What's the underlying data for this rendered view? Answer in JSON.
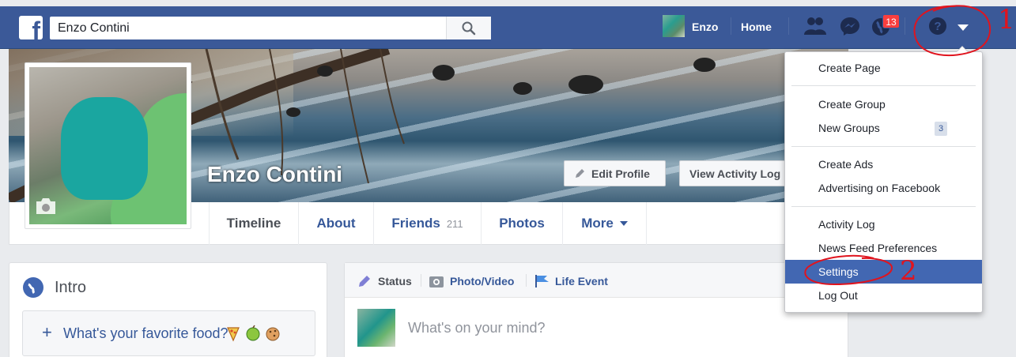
{
  "topbar": {
    "logo": "f",
    "search_value": "Enzo Contini",
    "user_name": "Enzo",
    "home_label": "Home",
    "notifications_count": "13"
  },
  "profile": {
    "name": "Enzo Contini",
    "edit_profile_label": "Edit Profile",
    "view_activity_label": "View Activity Log"
  },
  "tabs": {
    "timeline": "Timeline",
    "about": "About",
    "friends": "Friends",
    "friends_count": "211",
    "photos": "Photos",
    "more": "More"
  },
  "intro": {
    "title": "Intro",
    "favorite_food_prompt": "What's your favorite food?"
  },
  "composer": {
    "status": "Status",
    "photo_video": "Photo/Video",
    "life_event": "Life Event",
    "placeholder": "What's on your mind?"
  },
  "dropdown": {
    "create_page": "Create Page",
    "create_group": "Create Group",
    "new_groups": "New Groups",
    "new_groups_count": "3",
    "create_ads": "Create Ads",
    "advertising": "Advertising on Facebook",
    "activity_log": "Activity Log",
    "news_feed_prefs": "News Feed Preferences",
    "settings": "Settings",
    "log_out": "Log Out"
  },
  "annotations": {
    "step1": "1",
    "step2": "2"
  },
  "colors": {
    "brand": "#3b5998",
    "link": "#365899",
    "highlight": "#4267b2",
    "badge": "#fa3e3e",
    "annotation": "#e0141e"
  }
}
